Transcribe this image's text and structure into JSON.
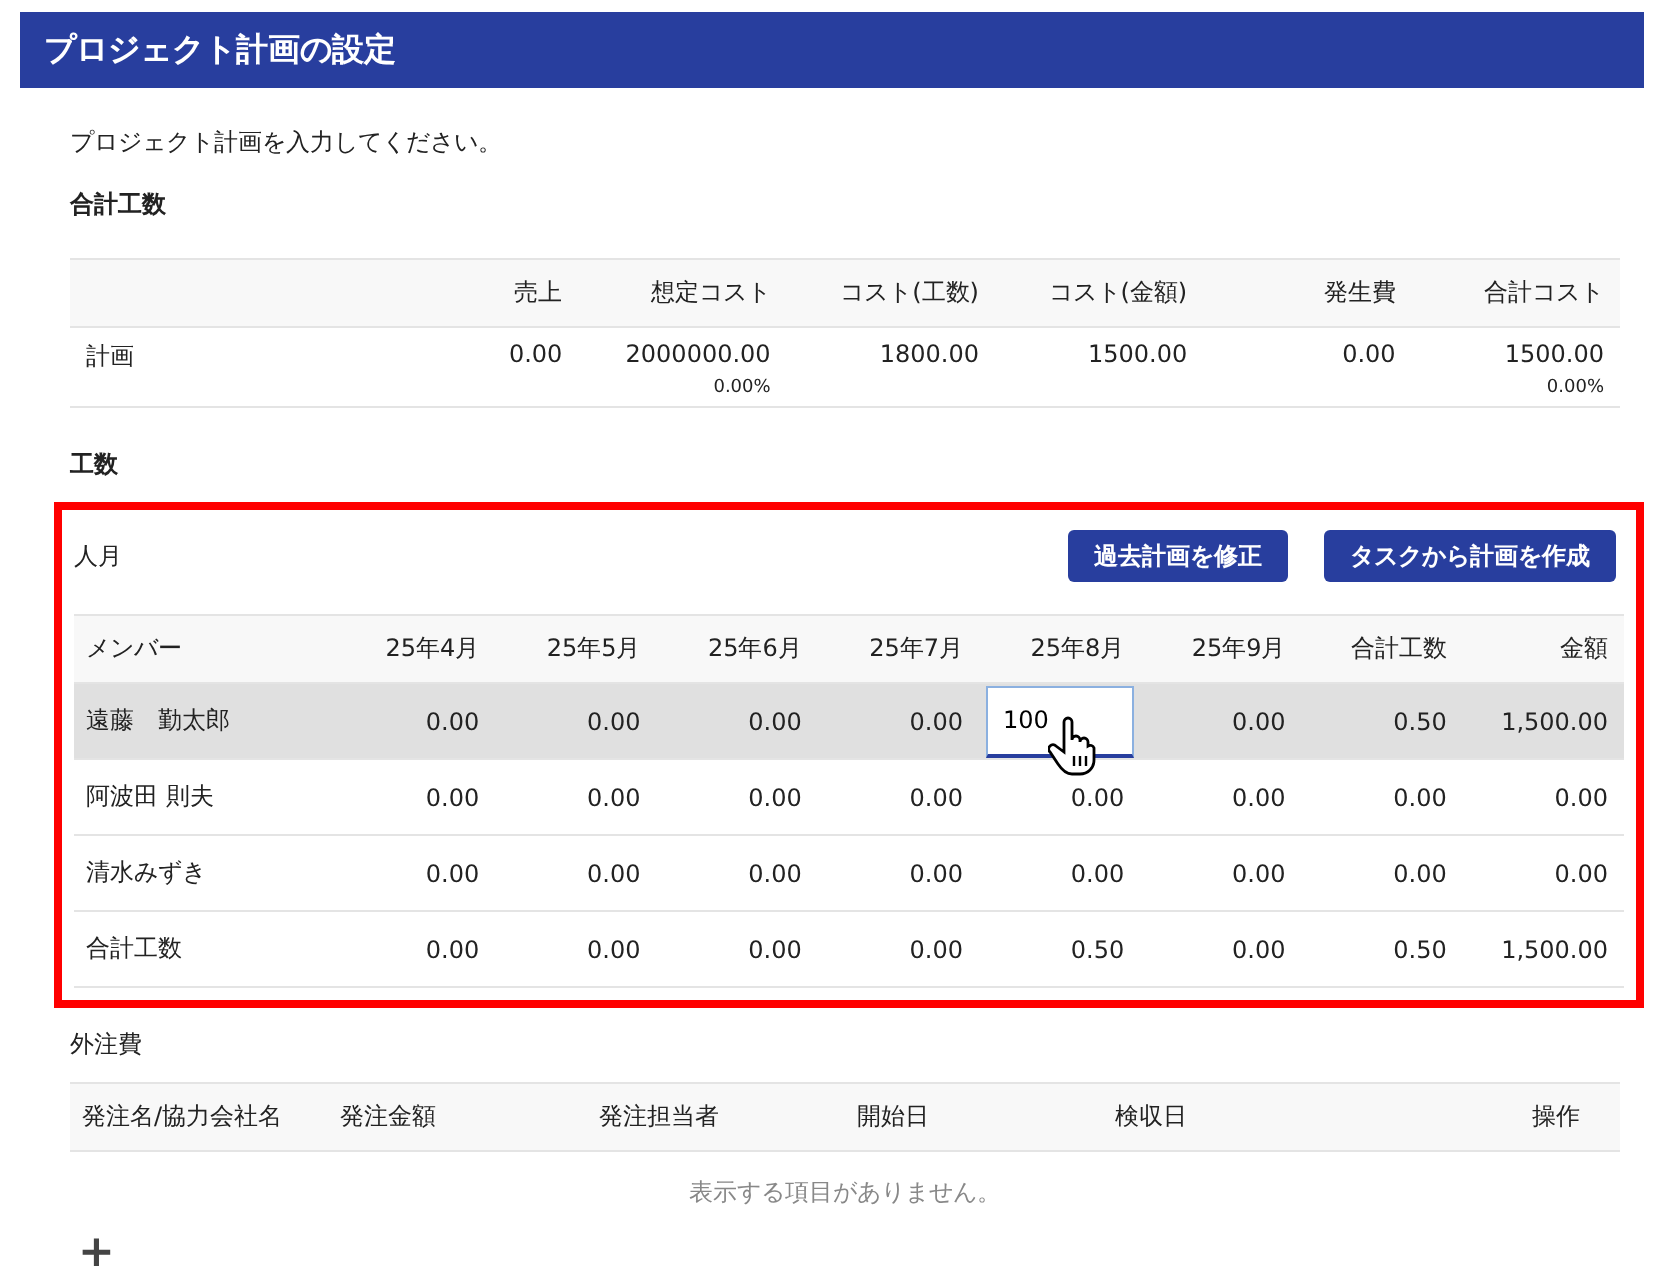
{
  "title": "プロジェクト計画の設定",
  "intro": "プロジェクト計画を入力してください。",
  "summary": {
    "heading": "合計工数",
    "columns": [
      "",
      "売上",
      "想定コスト",
      "コスト(工数)",
      "コスト(金額)",
      "発生費",
      "合計コスト"
    ],
    "rows": [
      {
        "cells": [
          {
            "value": "計画"
          },
          {
            "value": "0.00"
          },
          {
            "value": "2000000.00",
            "sub": "0.00%"
          },
          {
            "value": "1800.00"
          },
          {
            "value": "1500.00"
          },
          {
            "value": "0.00"
          },
          {
            "value": "1500.00",
            "sub": "0.00%"
          }
        ]
      }
    ]
  },
  "effort": {
    "heading": "工数",
    "highlighted": true,
    "unit": "人月",
    "buttons": [
      "過去計画を修正",
      "タスクから計画を作成"
    ],
    "columns": [
      "メンバー",
      "25年4月",
      "25年5月",
      "25年6月",
      "25年7月",
      "25年8月",
      "25年9月",
      "合計工数",
      "金額"
    ],
    "rows": [
      {
        "selected": true,
        "cells": [
          {
            "kind": "text",
            "value": "遠藤　勤太郎"
          },
          {
            "kind": "text",
            "value": "0.00"
          },
          {
            "kind": "text",
            "value": "0.00"
          },
          {
            "kind": "text",
            "value": "0.00"
          },
          {
            "kind": "text",
            "value": "0.00"
          },
          {
            "kind": "input",
            "value": "100"
          },
          {
            "kind": "text",
            "value": "0.00"
          },
          {
            "kind": "text",
            "value": "0.50"
          },
          {
            "kind": "text",
            "value": "1,500.00"
          }
        ]
      },
      {
        "selected": false,
        "cells": [
          {
            "kind": "text",
            "value": "阿波田 則夫"
          },
          {
            "kind": "text",
            "value": "0.00"
          },
          {
            "kind": "text",
            "value": "0.00"
          },
          {
            "kind": "text",
            "value": "0.00"
          },
          {
            "kind": "text",
            "value": "0.00"
          },
          {
            "kind": "text",
            "value": "0.00"
          },
          {
            "kind": "text",
            "value": "0.00"
          },
          {
            "kind": "text",
            "value": "0.00"
          },
          {
            "kind": "text",
            "value": "0.00"
          }
        ]
      },
      {
        "selected": false,
        "cells": [
          {
            "kind": "text",
            "value": "清水みずき"
          },
          {
            "kind": "text",
            "value": "0.00"
          },
          {
            "kind": "text",
            "value": "0.00"
          },
          {
            "kind": "text",
            "value": "0.00"
          },
          {
            "kind": "text",
            "value": "0.00"
          },
          {
            "kind": "text",
            "value": "0.00"
          },
          {
            "kind": "text",
            "value": "0.00"
          },
          {
            "kind": "text",
            "value": "0.00"
          },
          {
            "kind": "text",
            "value": "0.00"
          }
        ]
      },
      {
        "selected": false,
        "cells": [
          {
            "kind": "text",
            "value": "合計工数"
          },
          {
            "kind": "text",
            "value": "0.00"
          },
          {
            "kind": "text",
            "value": "0.00"
          },
          {
            "kind": "text",
            "value": "0.00"
          },
          {
            "kind": "text",
            "value": "0.00"
          },
          {
            "kind": "text",
            "value": "0.50"
          },
          {
            "kind": "text",
            "value": "0.00"
          },
          {
            "kind": "text",
            "value": "0.50"
          },
          {
            "kind": "text",
            "value": "1,500.00"
          }
        ]
      }
    ]
  },
  "outsourcing": {
    "heading": "外注費",
    "columns": [
      "発注名/協力会社名",
      "発注金額",
      "発注担当者",
      "開始日",
      "検収日",
      "操作"
    ],
    "empty_message": "表示する項目がありません。",
    "add_button": "+"
  }
}
